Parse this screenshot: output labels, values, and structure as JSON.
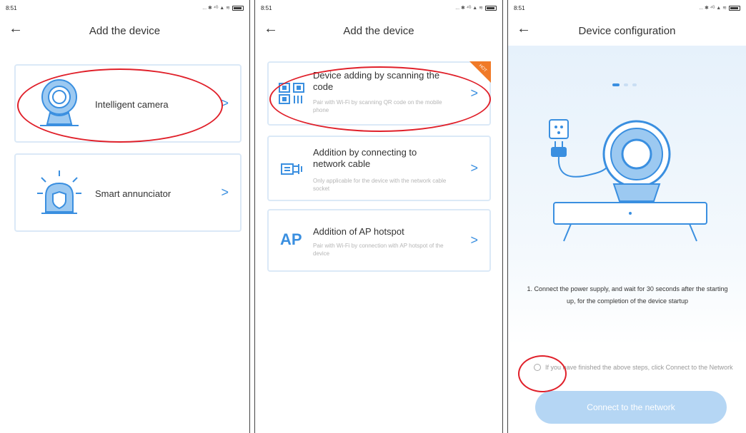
{
  "status": {
    "time": "8:51",
    "icons": "... ✱ ⁴ᴳ ▲ ≋"
  },
  "panel1": {
    "title": "Add the device",
    "items": [
      {
        "label": "Intelligent camera"
      },
      {
        "label": "Smart annunciator"
      }
    ]
  },
  "panel2": {
    "title": "Add the device",
    "items": [
      {
        "title": "Device adding by scanning the code",
        "desc": "Pair with Wi-Fi by scanning QR code on the mobile phone",
        "badge": "HOT",
        "icon_text": ""
      },
      {
        "title": "Addition by connecting to network cable",
        "desc": "Only applicable for the device with the network cable socket",
        "icon_text": ""
      },
      {
        "title": "Addition of AP hotspot",
        "desc": "Pair with Wi-Fi by connection with AP hotspot of the device",
        "icon_text": "AP"
      }
    ]
  },
  "panel3": {
    "title": "Device configuration",
    "step_text": "1. Connect the power supply, and wait for 30 seconds after the starting up, for the completion of the device startup",
    "checkbox_text": "If you have finished the above steps, click Connect to the Network",
    "button": "Connect to the network"
  },
  "colors": {
    "accent": "#3a8fe0",
    "card_border": "#dbe9f7",
    "annotation": "#e0202a",
    "hot_badge": "#f07a28",
    "button_disabled": "#b5d6f4"
  }
}
